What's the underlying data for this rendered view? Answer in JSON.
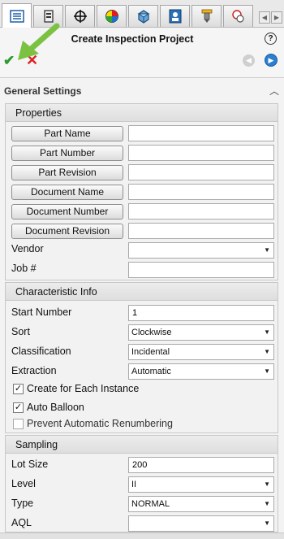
{
  "header": {
    "title": "Create Inspection Project",
    "help_symbol": "?",
    "ok_symbol": "✔",
    "cancel_symbol": "✕"
  },
  "tabs": [
    {
      "icon": "feature-tree-icon"
    },
    {
      "icon": "property-manager-icon"
    },
    {
      "icon": "crosshair-icon"
    },
    {
      "icon": "appearance-icon"
    },
    {
      "icon": "dimxpert-icon"
    },
    {
      "icon": "inspection-icon"
    },
    {
      "icon": "probe-icon"
    },
    {
      "icon": "balloon-icon"
    }
  ],
  "section": {
    "title": "General Settings"
  },
  "properties": {
    "title": "Properties",
    "buttons": {
      "part_name": "Part Name",
      "part_number": "Part Number",
      "part_revision": "Part Revision",
      "document_name": "Document Name",
      "document_number": "Document Number",
      "document_revision": "Document Revision"
    },
    "vendor_label": "Vendor",
    "vendor_value": "",
    "job_label": "Job #",
    "job_value": ""
  },
  "characteristic": {
    "title": "Characteristic Info",
    "start_number_label": "Start Number",
    "start_number_value": "1",
    "sort_label": "Sort",
    "sort_value": "Clockwise",
    "classification_label": "Classification",
    "classification_value": "Incidental",
    "extraction_label": "Extraction",
    "extraction_value": "Automatic",
    "create_each_label": "Create for Each Instance",
    "create_each_checked": true,
    "auto_balloon_label": "Auto Balloon",
    "auto_balloon_checked": true,
    "prevent_renumber_label": "Prevent Automatic Renumbering",
    "prevent_renumber_checked": false
  },
  "sampling": {
    "title": "Sampling",
    "lot_size_label": "Lot Size",
    "lot_size_value": "200",
    "level_label": "Level",
    "level_value": "II",
    "type_label": "Type",
    "type_value": "NORMAL",
    "aql_label": "AQL",
    "aql_value": ""
  },
  "colors": {
    "ok": "#2e9b2e",
    "cancel": "#dd2222",
    "annotation_arrow": "#7cc242",
    "nav_forward": "#2b7fcf"
  }
}
